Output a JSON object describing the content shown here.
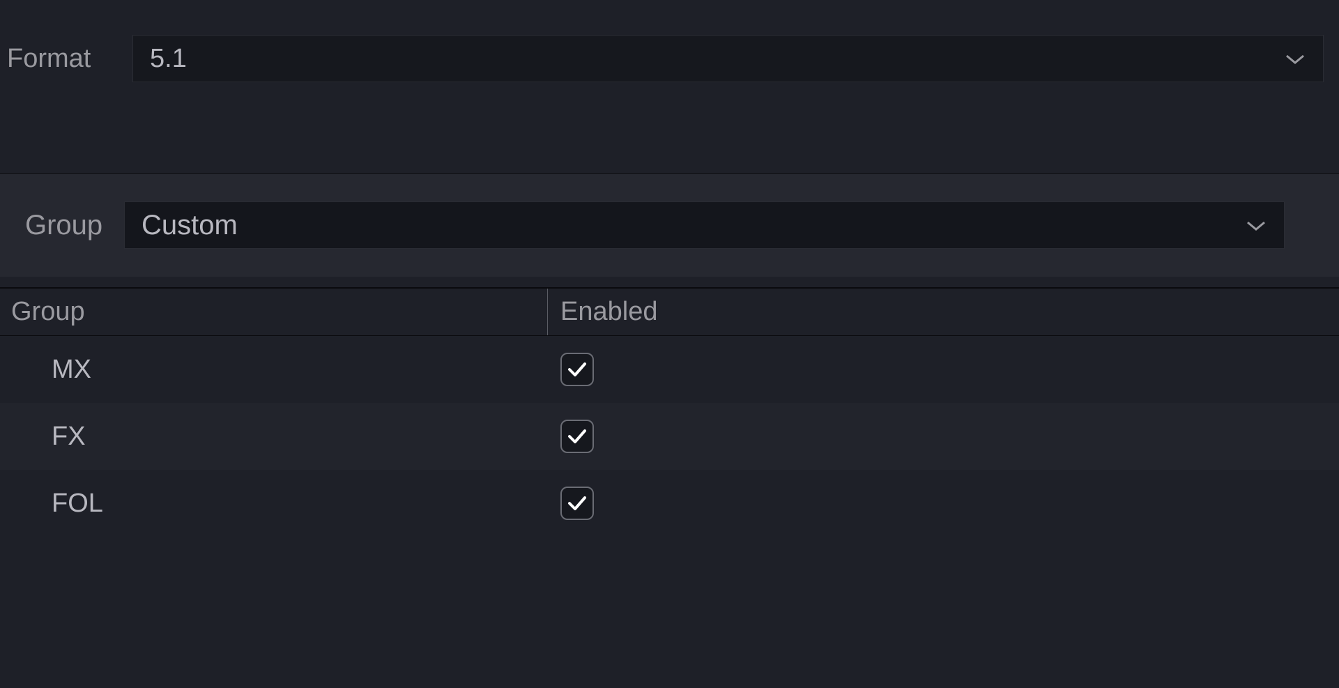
{
  "format": {
    "label": "Format",
    "value": "5.1"
  },
  "group": {
    "label": "Group",
    "value": "Custom"
  },
  "table": {
    "headers": {
      "group": "Group",
      "enabled": "Enabled"
    },
    "rows": [
      {
        "name": "MX",
        "enabled": true
      },
      {
        "name": "FX",
        "enabled": true
      },
      {
        "name": "FOL",
        "enabled": true
      }
    ]
  }
}
